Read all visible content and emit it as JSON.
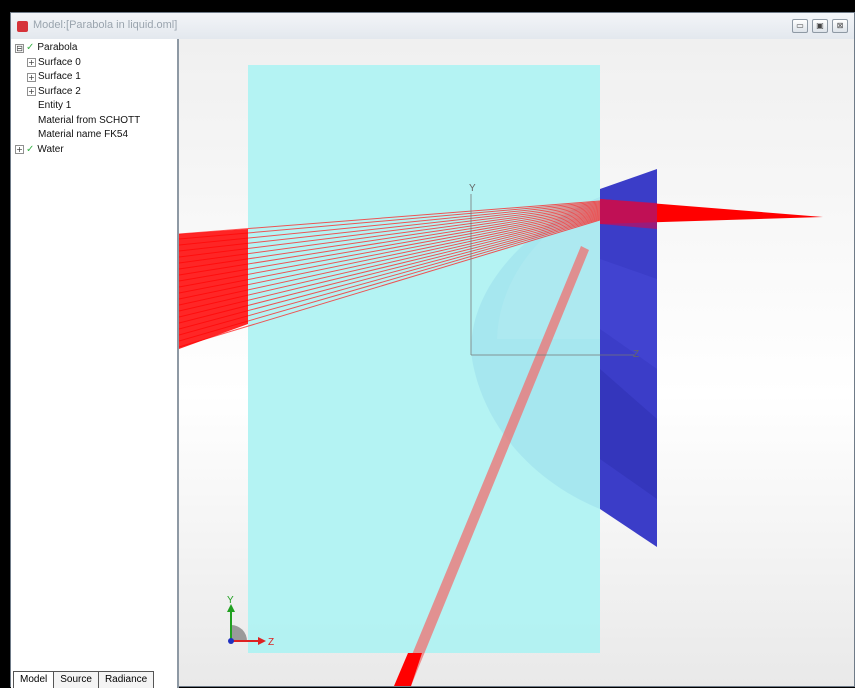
{
  "window": {
    "title": "Model:[Parabola in liquid.oml]",
    "buttons": [
      {
        "name": "minimize",
        "glyph": "▭"
      },
      {
        "name": "restore",
        "glyph": "▣"
      },
      {
        "name": "close",
        "glyph": "⊠"
      }
    ]
  },
  "tree": {
    "items": [
      {
        "label": "Parabola",
        "expander": "⊟",
        "check": "✓"
      },
      {
        "label": "Surface 0",
        "expander": "+"
      },
      {
        "label": "Surface 1",
        "expander": "+"
      },
      {
        "label": "Surface 2",
        "expander": "+"
      },
      {
        "label": "Entity 1"
      },
      {
        "label": "Material from SCHOTT"
      },
      {
        "label": "Material name FK54"
      },
      {
        "label": "Water",
        "expander": "+",
        "check": "✓"
      }
    ]
  },
  "tabs": [
    {
      "label": "Model"
    },
    {
      "label": "Source"
    },
    {
      "label": "Radiance"
    }
  ],
  "viewport": {
    "axis_labels": {
      "y": "Y",
      "z": "Z"
    },
    "triad_labels": {
      "y": "Y",
      "z": "Z"
    },
    "colors": {
      "water": "#b0f2f2",
      "parabola_body": "#9ee6f0",
      "surface_plane": "#3b3dc8",
      "rays": "#ff0000"
    },
    "icons": [
      "axis-triad-icon"
    ]
  }
}
